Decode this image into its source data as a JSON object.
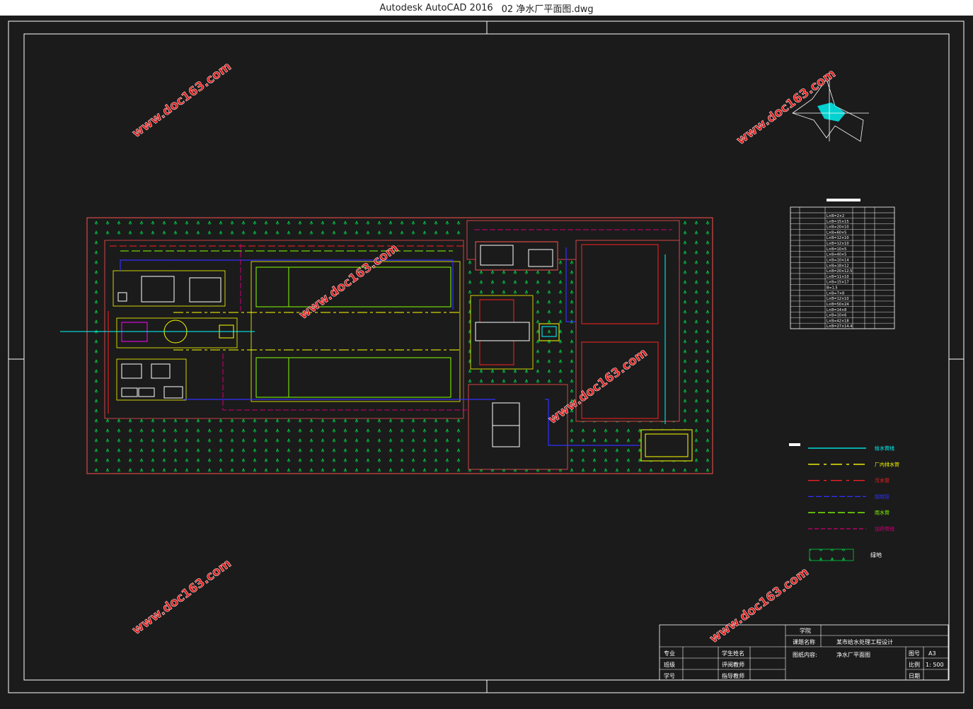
{
  "window": {
    "app_name": "Autodesk AutoCAD 2016",
    "file_name": "02 净水厂平面图.dwg"
  },
  "drawing": {
    "watermark": "www.doc163.com",
    "structure_table": {
      "rows": [
        "L×B=2×2",
        "L×B=15×15",
        "L×B=20×10",
        "L×B=60×5",
        "L×B=12×10",
        "L×B=12×10",
        "L×B=10×5",
        "L×B=40×5",
        "L×B=10×14",
        "L×B=18×12",
        "L×B=20×12.5",
        "L×B=11×10",
        "L×B=15×17",
        "B=1.5",
        "L×B=7×8",
        "L×B=12×10",
        "L×B=50×24",
        "L×B=14×8",
        "L×B=10×6",
        "L×B=42×18",
        "L×B=27×14.4"
      ]
    },
    "legend": {
      "items": [
        {
          "label": "给水管线",
          "color": "#00ffff"
        },
        {
          "label": "厂内排水管",
          "color": "#ffff00"
        },
        {
          "label": "污水管",
          "color": "#ff2020"
        },
        {
          "label": "超越管",
          "color": "#3030ff"
        },
        {
          "label": "雨水管",
          "color": "#80ff00"
        },
        {
          "label": "加药管线",
          "color": "#cc0077"
        }
      ],
      "green_label": "绿地"
    },
    "title_block": {
      "school_label": "学院",
      "project_label": "课题名称",
      "project_value": "某市给水处理工程设计",
      "drawing_label": "图纸内容:",
      "drawing_value": "净水厂平面图",
      "major_label": "专业",
      "class_label": "班级",
      "id_label": "学号",
      "student_label": "学生姓名",
      "reviewer_label": "评阅教师",
      "advisor_label": "指导教师",
      "sheet_label": "图号",
      "sheet_value": "A3",
      "scale_label": "比例",
      "scale_value": "1: 500",
      "date_label": "日期"
    },
    "colors": {
      "boundary": "#ff5050",
      "green": "#00cc44",
      "yellow": "#ffff00",
      "cyan": "#00ffff",
      "blue": "#3030ff",
      "magenta": "#cc0077",
      "frame": "#ffffff",
      "watermark": "#e01818"
    }
  }
}
